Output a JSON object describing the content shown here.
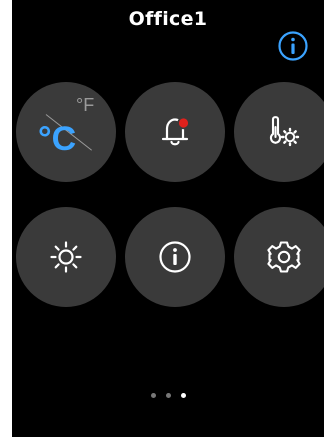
{
  "header": {
    "title": "Office1",
    "info_icon": "info-circle-icon"
  },
  "tiles": [
    {
      "id": "units",
      "icon": "celsius-fahrenheit-icon",
      "unit_primary": "°C",
      "unit_secondary": "°F"
    },
    {
      "id": "alarms",
      "icon": "bell-alert-icon",
      "badge_color": "#e0211c"
    },
    {
      "id": "temperature-settings",
      "icon": "thermometer-gear-icon"
    },
    {
      "id": "brightness",
      "icon": "sun-icon"
    },
    {
      "id": "info",
      "icon": "info-circle-icon"
    },
    {
      "id": "settings",
      "icon": "gear-icon"
    }
  ],
  "pager": {
    "pages": 3,
    "active_index": 2
  },
  "colors": {
    "background": "#000000",
    "tile": "#3a3a3a",
    "accent_blue": "#3ba3ff",
    "alert_red": "#e0211c",
    "icon_white": "#ffffff"
  }
}
